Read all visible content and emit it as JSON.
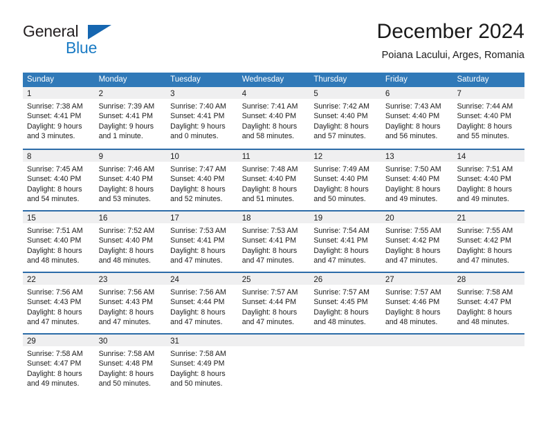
{
  "brand": {
    "name_part1": "General",
    "name_part2": "Blue",
    "logo_icon": "triangle-flag-icon"
  },
  "header": {
    "title": "December 2024",
    "subtitle": "Poiana Lacului, Arges, Romania"
  },
  "calendar": {
    "weekday_headers": [
      "Sunday",
      "Monday",
      "Tuesday",
      "Wednesday",
      "Thursday",
      "Friday",
      "Saturday"
    ],
    "accent_color": "#3079b8",
    "header_rule_color": "#2b6ba8",
    "day_band_color": "#efeff0",
    "weeks": [
      [
        {
          "day": "1",
          "sunrise": "Sunrise: 7:38 AM",
          "sunset": "Sunset: 4:41 PM",
          "daylight_line1": "Daylight: 9 hours",
          "daylight_line2": "and 3 minutes."
        },
        {
          "day": "2",
          "sunrise": "Sunrise: 7:39 AM",
          "sunset": "Sunset: 4:41 PM",
          "daylight_line1": "Daylight: 9 hours",
          "daylight_line2": "and 1 minute."
        },
        {
          "day": "3",
          "sunrise": "Sunrise: 7:40 AM",
          "sunset": "Sunset: 4:41 PM",
          "daylight_line1": "Daylight: 9 hours",
          "daylight_line2": "and 0 minutes."
        },
        {
          "day": "4",
          "sunrise": "Sunrise: 7:41 AM",
          "sunset": "Sunset: 4:40 PM",
          "daylight_line1": "Daylight: 8 hours",
          "daylight_line2": "and 58 minutes."
        },
        {
          "day": "5",
          "sunrise": "Sunrise: 7:42 AM",
          "sunset": "Sunset: 4:40 PM",
          "daylight_line1": "Daylight: 8 hours",
          "daylight_line2": "and 57 minutes."
        },
        {
          "day": "6",
          "sunrise": "Sunrise: 7:43 AM",
          "sunset": "Sunset: 4:40 PM",
          "daylight_line1": "Daylight: 8 hours",
          "daylight_line2": "and 56 minutes."
        },
        {
          "day": "7",
          "sunrise": "Sunrise: 7:44 AM",
          "sunset": "Sunset: 4:40 PM",
          "daylight_line1": "Daylight: 8 hours",
          "daylight_line2": "and 55 minutes."
        }
      ],
      [
        {
          "day": "8",
          "sunrise": "Sunrise: 7:45 AM",
          "sunset": "Sunset: 4:40 PM",
          "daylight_line1": "Daylight: 8 hours",
          "daylight_line2": "and 54 minutes."
        },
        {
          "day": "9",
          "sunrise": "Sunrise: 7:46 AM",
          "sunset": "Sunset: 4:40 PM",
          "daylight_line1": "Daylight: 8 hours",
          "daylight_line2": "and 53 minutes."
        },
        {
          "day": "10",
          "sunrise": "Sunrise: 7:47 AM",
          "sunset": "Sunset: 4:40 PM",
          "daylight_line1": "Daylight: 8 hours",
          "daylight_line2": "and 52 minutes."
        },
        {
          "day": "11",
          "sunrise": "Sunrise: 7:48 AM",
          "sunset": "Sunset: 4:40 PM",
          "daylight_line1": "Daylight: 8 hours",
          "daylight_line2": "and 51 minutes."
        },
        {
          "day": "12",
          "sunrise": "Sunrise: 7:49 AM",
          "sunset": "Sunset: 4:40 PM",
          "daylight_line1": "Daylight: 8 hours",
          "daylight_line2": "and 50 minutes."
        },
        {
          "day": "13",
          "sunrise": "Sunrise: 7:50 AM",
          "sunset": "Sunset: 4:40 PM",
          "daylight_line1": "Daylight: 8 hours",
          "daylight_line2": "and 49 minutes."
        },
        {
          "day": "14",
          "sunrise": "Sunrise: 7:51 AM",
          "sunset": "Sunset: 4:40 PM",
          "daylight_line1": "Daylight: 8 hours",
          "daylight_line2": "and 49 minutes."
        }
      ],
      [
        {
          "day": "15",
          "sunrise": "Sunrise: 7:51 AM",
          "sunset": "Sunset: 4:40 PM",
          "daylight_line1": "Daylight: 8 hours",
          "daylight_line2": "and 48 minutes."
        },
        {
          "day": "16",
          "sunrise": "Sunrise: 7:52 AM",
          "sunset": "Sunset: 4:40 PM",
          "daylight_line1": "Daylight: 8 hours",
          "daylight_line2": "and 48 minutes."
        },
        {
          "day": "17",
          "sunrise": "Sunrise: 7:53 AM",
          "sunset": "Sunset: 4:41 PM",
          "daylight_line1": "Daylight: 8 hours",
          "daylight_line2": "and 47 minutes."
        },
        {
          "day": "18",
          "sunrise": "Sunrise: 7:53 AM",
          "sunset": "Sunset: 4:41 PM",
          "daylight_line1": "Daylight: 8 hours",
          "daylight_line2": "and 47 minutes."
        },
        {
          "day": "19",
          "sunrise": "Sunrise: 7:54 AM",
          "sunset": "Sunset: 4:41 PM",
          "daylight_line1": "Daylight: 8 hours",
          "daylight_line2": "and 47 minutes."
        },
        {
          "day": "20",
          "sunrise": "Sunrise: 7:55 AM",
          "sunset": "Sunset: 4:42 PM",
          "daylight_line1": "Daylight: 8 hours",
          "daylight_line2": "and 47 minutes."
        },
        {
          "day": "21",
          "sunrise": "Sunrise: 7:55 AM",
          "sunset": "Sunset: 4:42 PM",
          "daylight_line1": "Daylight: 8 hours",
          "daylight_line2": "and 47 minutes."
        }
      ],
      [
        {
          "day": "22",
          "sunrise": "Sunrise: 7:56 AM",
          "sunset": "Sunset: 4:43 PM",
          "daylight_line1": "Daylight: 8 hours",
          "daylight_line2": "and 47 minutes."
        },
        {
          "day": "23",
          "sunrise": "Sunrise: 7:56 AM",
          "sunset": "Sunset: 4:43 PM",
          "daylight_line1": "Daylight: 8 hours",
          "daylight_line2": "and 47 minutes."
        },
        {
          "day": "24",
          "sunrise": "Sunrise: 7:56 AM",
          "sunset": "Sunset: 4:44 PM",
          "daylight_line1": "Daylight: 8 hours",
          "daylight_line2": "and 47 minutes."
        },
        {
          "day": "25",
          "sunrise": "Sunrise: 7:57 AM",
          "sunset": "Sunset: 4:44 PM",
          "daylight_line1": "Daylight: 8 hours",
          "daylight_line2": "and 47 minutes."
        },
        {
          "day": "26",
          "sunrise": "Sunrise: 7:57 AM",
          "sunset": "Sunset: 4:45 PM",
          "daylight_line1": "Daylight: 8 hours",
          "daylight_line2": "and 48 minutes."
        },
        {
          "day": "27",
          "sunrise": "Sunrise: 7:57 AM",
          "sunset": "Sunset: 4:46 PM",
          "daylight_line1": "Daylight: 8 hours",
          "daylight_line2": "and 48 minutes."
        },
        {
          "day": "28",
          "sunrise": "Sunrise: 7:58 AM",
          "sunset": "Sunset: 4:47 PM",
          "daylight_line1": "Daylight: 8 hours",
          "daylight_line2": "and 48 minutes."
        }
      ],
      [
        {
          "day": "29",
          "sunrise": "Sunrise: 7:58 AM",
          "sunset": "Sunset: 4:47 PM",
          "daylight_line1": "Daylight: 8 hours",
          "daylight_line2": "and 49 minutes."
        },
        {
          "day": "30",
          "sunrise": "Sunrise: 7:58 AM",
          "sunset": "Sunset: 4:48 PM",
          "daylight_line1": "Daylight: 8 hours",
          "daylight_line2": "and 50 minutes."
        },
        {
          "day": "31",
          "sunrise": "Sunrise: 7:58 AM",
          "sunset": "Sunset: 4:49 PM",
          "daylight_line1": "Daylight: 8 hours",
          "daylight_line2": "and 50 minutes."
        },
        {
          "day": "",
          "sunrise": "",
          "sunset": "",
          "daylight_line1": "",
          "daylight_line2": ""
        },
        {
          "day": "",
          "sunrise": "",
          "sunset": "",
          "daylight_line1": "",
          "daylight_line2": ""
        },
        {
          "day": "",
          "sunrise": "",
          "sunset": "",
          "daylight_line1": "",
          "daylight_line2": ""
        },
        {
          "day": "",
          "sunrise": "",
          "sunset": "",
          "daylight_line1": "",
          "daylight_line2": ""
        }
      ]
    ]
  }
}
